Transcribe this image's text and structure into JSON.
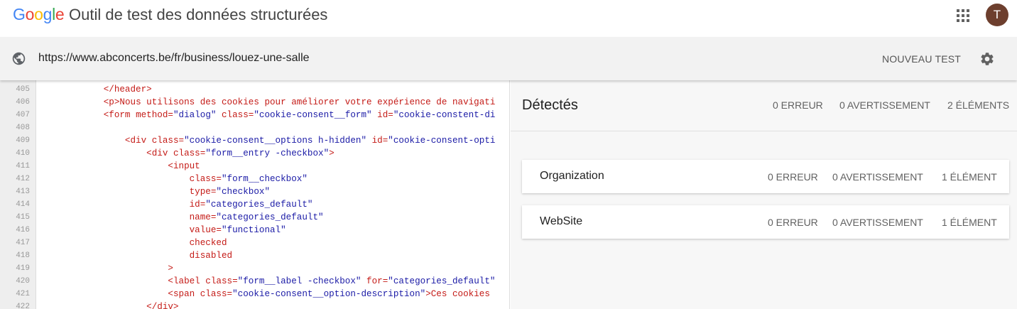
{
  "header": {
    "logo_letters": [
      "G",
      "o",
      "o",
      "g",
      "l",
      "e"
    ],
    "logo_colors": [
      "#4285f4",
      "#ea4335",
      "#fbbc05",
      "#4285f4",
      "#34a853",
      "#ea4335"
    ],
    "title": "Outil de test des données structurées",
    "avatar_initial": "T",
    "icons": [
      "apps-grid-icon"
    ]
  },
  "urlbar": {
    "url": "https://www.abconcerts.be/fr/business/louez-une-salle",
    "new_test_label": "NOUVEAU TEST",
    "icons": [
      "globe-icon",
      "gear-icon"
    ]
  },
  "code": {
    "lines": [
      {
        "n": "405",
        "indent": "            ",
        "tokens": [
          [
            "t-tag",
            "</header>"
          ]
        ]
      },
      {
        "n": "406",
        "indent": "            ",
        "tokens": [
          [
            "t-tag",
            "<p>"
          ],
          [
            "t-text",
            "Nous utilisons des cookies pour améliorer votre expérience de navigati"
          ]
        ]
      },
      {
        "n": "407",
        "indent": "            ",
        "tokens": [
          [
            "t-tag",
            "<form "
          ],
          [
            "t-attr",
            "method="
          ],
          [
            "t-str",
            "\"dialog\""
          ],
          [
            "t-attr",
            " class="
          ],
          [
            "t-str",
            "\"cookie-consent__form\""
          ],
          [
            "t-attr",
            " id="
          ],
          [
            "t-str",
            "\"cookie-constent-di"
          ]
        ]
      },
      {
        "n": "408",
        "indent": "",
        "tokens": []
      },
      {
        "n": "409",
        "indent": "                ",
        "tokens": [
          [
            "t-tag",
            "<div "
          ],
          [
            "t-attr",
            "class="
          ],
          [
            "t-str",
            "\"cookie-consent__options h-hidden\""
          ],
          [
            "t-attr",
            " id="
          ],
          [
            "t-str",
            "\"cookie-consent-opti"
          ]
        ]
      },
      {
        "n": "410",
        "indent": "                    ",
        "tokens": [
          [
            "t-tag",
            "<div "
          ],
          [
            "t-attr",
            "class="
          ],
          [
            "t-str",
            "\"form__entry -checkbox\""
          ],
          [
            "t-tag",
            ">"
          ]
        ]
      },
      {
        "n": "411",
        "indent": "                        ",
        "tokens": [
          [
            "t-tag",
            "<input"
          ]
        ]
      },
      {
        "n": "412",
        "indent": "                            ",
        "tokens": [
          [
            "t-attr",
            "class="
          ],
          [
            "t-str",
            "\"form__checkbox\""
          ]
        ]
      },
      {
        "n": "413",
        "indent": "                            ",
        "tokens": [
          [
            "t-attr",
            "type="
          ],
          [
            "t-str",
            "\"checkbox\""
          ]
        ]
      },
      {
        "n": "414",
        "indent": "                            ",
        "tokens": [
          [
            "t-attr",
            "id="
          ],
          [
            "t-str",
            "\"categories_default\""
          ]
        ]
      },
      {
        "n": "415",
        "indent": "                            ",
        "tokens": [
          [
            "t-attr",
            "name="
          ],
          [
            "t-str",
            "\"categories_default\""
          ]
        ]
      },
      {
        "n": "416",
        "indent": "                            ",
        "tokens": [
          [
            "t-attr",
            "value="
          ],
          [
            "t-str",
            "\"functional\""
          ]
        ]
      },
      {
        "n": "417",
        "indent": "                            ",
        "tokens": [
          [
            "t-attr",
            "checked"
          ]
        ]
      },
      {
        "n": "418",
        "indent": "                            ",
        "tokens": [
          [
            "t-attr",
            "disabled"
          ]
        ]
      },
      {
        "n": "419",
        "indent": "                        ",
        "tokens": [
          [
            "t-tag",
            ">"
          ]
        ]
      },
      {
        "n": "420",
        "indent": "                        ",
        "tokens": [
          [
            "t-tag",
            "<label "
          ],
          [
            "t-attr",
            "class="
          ],
          [
            "t-str",
            "\"form__label -checkbox\""
          ],
          [
            "t-attr",
            " for="
          ],
          [
            "t-str",
            "\"categories_default\""
          ]
        ]
      },
      {
        "n": "421",
        "indent": "                        ",
        "tokens": [
          [
            "t-tag",
            "<span "
          ],
          [
            "t-attr",
            "class="
          ],
          [
            "t-str",
            "\"cookie-consent__option-description\""
          ],
          [
            "t-tag",
            ">"
          ],
          [
            "t-text",
            "Ces cookies"
          ]
        ]
      },
      {
        "n": "422",
        "indent": "                    ",
        "tokens": [
          [
            "t-tag",
            "</div>"
          ]
        ]
      }
    ]
  },
  "results": {
    "title": "Détectés",
    "errors": "0 ERREUR",
    "warnings": "0 AVERTISSEMENT",
    "elements": "2 ÉLÉMENTS",
    "items": [
      {
        "name": "Organization",
        "errors": "0 ERREUR",
        "warnings": "0 AVERTISSEMENT",
        "elements": "1 ÉLÉMENT"
      },
      {
        "name": "WebSite",
        "errors": "0 ERREUR",
        "warnings": "0 AVERTISSEMENT",
        "elements": "1 ÉLÉMENT"
      }
    ]
  }
}
